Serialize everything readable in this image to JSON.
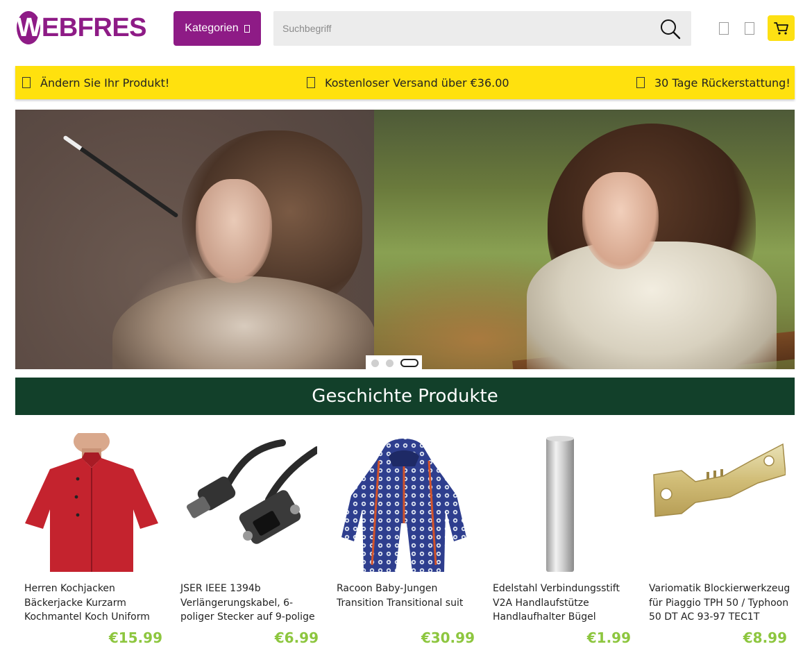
{
  "header": {
    "logo_letter": "W",
    "logo_rest": "EBFRES",
    "categories_label": "Kategorien",
    "search_placeholder": "Suchbegriff"
  },
  "infobar": {
    "items": [
      "Ändern Sie Ihr Produkt!",
      "Kostenloser Versand über €36.00",
      "30 Tage Rückerstattung!"
    ]
  },
  "slider": {
    "slide_count": 3,
    "active_slide": 3
  },
  "section": {
    "title": "Geschichte Produkte"
  },
  "products": [
    {
      "name": "Herren Kochjacken Bäckerjacke Kurzarm Kochmantel Koch Uniform",
      "price": "€15.99"
    },
    {
      "name": "JSER IEEE 1394b Verlängerungskabel, 6-poliger Stecker auf 9-polige",
      "price": "€6.99"
    },
    {
      "name": "Racoon Baby-Jungen Transition Transitional suit",
      "price": "€30.99"
    },
    {
      "name": "Edelstahl Verbindungsstift V2A Handlaufstütze Handlaufhalter Bügel",
      "price": "€1.99"
    },
    {
      "name": "Variomatik Blockierwerkzeug für Piaggio TPH 50 / Typhoon 50 DT AC 93-97 TEC1T",
      "price": "€8.99"
    }
  ],
  "colors": {
    "brand": "#8e1b86",
    "accent_yellow": "#ffe10e",
    "section_green": "#12402a",
    "price_green": "#8dc63f"
  },
  "icons": [
    "search-icon",
    "box-icon",
    "user-icon",
    "heart-icon",
    "cart-icon"
  ]
}
